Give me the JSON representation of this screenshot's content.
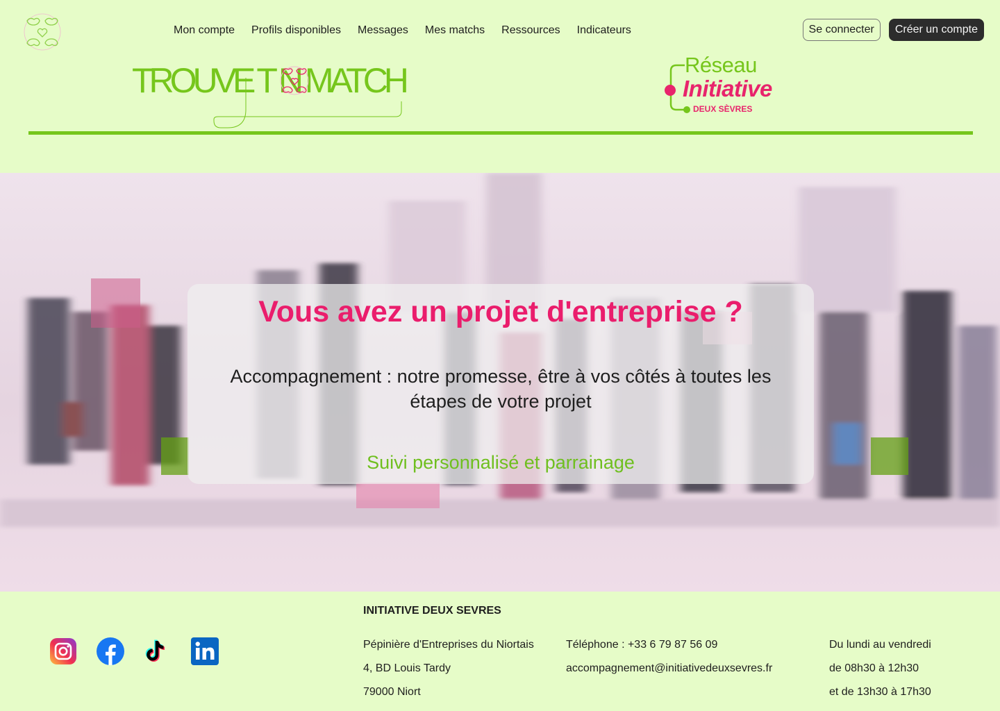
{
  "nav": {
    "items": [
      "Mon compte",
      "Profils disponibles",
      "Messages",
      "Mes matchs",
      "Ressources",
      "Indicateurs"
    ]
  },
  "auth": {
    "login": "Se connecter",
    "signup": "Créer un compte"
  },
  "brand": {
    "title": "TROUVE T  N  MATCH"
  },
  "partner": {
    "line1": "Réseau",
    "line2": "Initiative",
    "line3": "DEUX SÈVRES"
  },
  "hero": {
    "title": "Vous avez un projet d'entreprise ?",
    "subtitle": "Accompagnement : notre promesse, être à vos côtés à toutes les étapes de votre projet",
    "link": "Suivi personnalisé et parrainage"
  },
  "footer": {
    "org": "INITIATIVE DEUX SEVRES",
    "address": [
      "Pépinière d'Entreprises du Niortais",
      "4, BD Louis Tardy",
      "79000 Niort"
    ],
    "contact": [
      "Téléphone : +33 6 79 87 56 09",
      "accompagnement@initiativedeuxsevres.fr"
    ],
    "hours": [
      "Du lundi au vendredi",
      "de 08h30 à 12h30",
      "et de 13h30 à 17h30"
    ]
  },
  "social": [
    "instagram-icon",
    "facebook-icon",
    "tiktok-icon",
    "linkedin-icon"
  ],
  "colors": {
    "background": "#e6fcc8",
    "green": "#76c61c",
    "pink": "#ea1d6c",
    "dark": "#2c2c2c"
  }
}
